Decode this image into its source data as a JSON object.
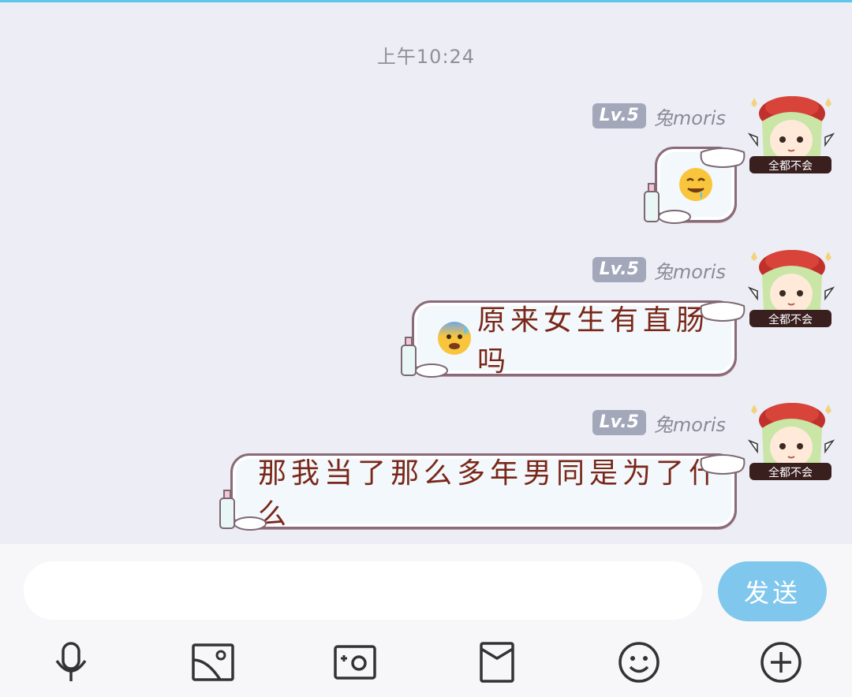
{
  "chat": {
    "timestamp": "上午10:24",
    "messages": [
      {
        "level": "Lv.5",
        "nickname": "兔moris",
        "text": "",
        "emoji": "drooling-face-emoji",
        "avatar_caption": "全都不会"
      },
      {
        "level": "Lv.5",
        "nickname": "兔moris",
        "text": "原来女生有直肠吗",
        "emoji": "anxious-face-emoji",
        "avatar_caption": "全都不会"
      },
      {
        "level": "Lv.5",
        "nickname": "兔moris",
        "text": "那我当了那么多年男同是为了什么",
        "emoji": "",
        "avatar_caption": "全都不会"
      }
    ]
  },
  "composer": {
    "placeholder": "",
    "send_label": "发送"
  },
  "toolbar": {
    "icons": [
      "microphone-icon",
      "image-icon",
      "camera-icon",
      "red-packet-icon",
      "emoji-icon",
      "plus-icon"
    ]
  },
  "colors": {
    "accent": "#7fc7ec",
    "bubble_text": "#7a2618",
    "level_badge": "#a3a7ba",
    "background": "#ecedf5"
  }
}
